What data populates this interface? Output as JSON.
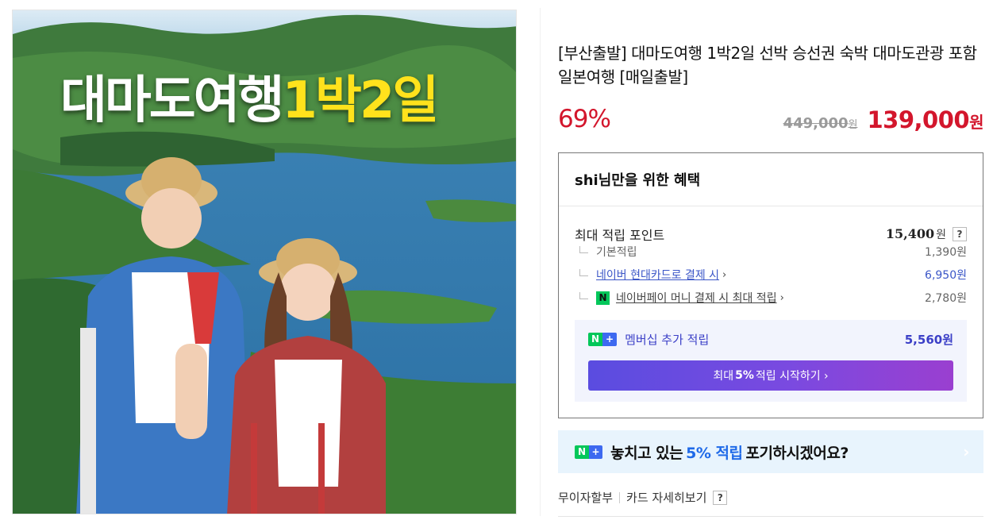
{
  "hero": {
    "title_main": "대마도여행",
    "title_highlight": "1박2일",
    "alt": "product-image"
  },
  "product": {
    "title": "[부산출발] 대마도여행 1박2일 선박 승선권 숙박 대마도관광 포함 일본여행 [매일출발]",
    "discount": "69%",
    "original_price": "449,000",
    "original_unit": "원",
    "price": "139,000",
    "price_unit": "원"
  },
  "benefit": {
    "heading": "shi님만을 위한 혜택",
    "max_points_label": "최대 적립 포인트",
    "max_points_value": "15,400",
    "max_points_unit": "원",
    "help": "?",
    "items": [
      {
        "label": "기본적립",
        "value": "1,390원"
      },
      {
        "label": "네이버 현대카드로 결제 시",
        "value": "6,950원"
      },
      {
        "label": "네이버페이 머니 결제 시 최대 적립",
        "value": "2,780원"
      }
    ],
    "npay_badge": "N",
    "membership": {
      "badge_n": "N",
      "badge_plus": "+",
      "label": "멤버십 추가 적립",
      "value": "5,560원",
      "cta_prefix": "최대",
      "cta_bold": "5%",
      "cta_suffix": "적립 시작하기 ›"
    }
  },
  "banner": {
    "badge_n": "N",
    "badge_plus": "+",
    "text_before": "놓치고 있는",
    "highlight": "5% 적립",
    "text_after": "포기하시겠어요?",
    "arrow": "›"
  },
  "install": {
    "installment": "무이자할부",
    "card_detail": "카드 자세히보기",
    "help": "?"
  },
  "colors": {
    "price_red": "#d3162c",
    "link_blue": "#3b56c7",
    "naver_green": "#03c75a",
    "membership_bg": "#f2f4fd",
    "banner_bg": "#e8f4fd"
  }
}
